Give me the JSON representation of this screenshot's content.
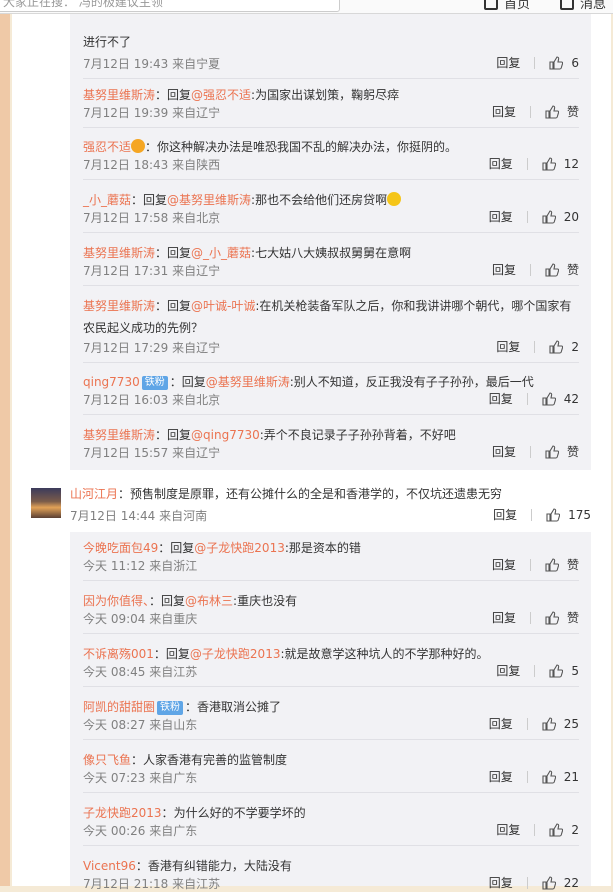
{
  "topbar": {
    "search_text": "大家正在搜：  冯的极建议主领",
    "home_label": "首页",
    "msg_label": "消息"
  },
  "first_partial": {
    "text": "进行不了",
    "time": "7月12日 19:43 来自宁夏",
    "reply": "回复",
    "likes": "6"
  },
  "replies_a": [
    {
      "user": "基努里维斯涛",
      "prefix": "：回复",
      "at": "@强忍不适",
      "body": ":为国家出谋划策，鞠躬尽瘁",
      "time": "7月12日 19:39 来自辽宁",
      "reply": "回复",
      "likes": "赞"
    },
    {
      "user": "强忍不适",
      "emoji": "fire",
      "prefix": "：",
      "at": "",
      "body": "你这种解决办法是唯恐我国不乱的解决办法，你挺阴的。",
      "time": "7月12日 18:43 来自陕西",
      "reply": "回复",
      "likes": "12"
    },
    {
      "user": "_小_蘑菇",
      "prefix": "：回复",
      "at": "@基努里维斯涛",
      "body": ":那也不会给他们还房贷啊",
      "emoji_end": "smile",
      "time": "7月12日 17:58 来自北京",
      "reply": "回复",
      "likes": "20"
    },
    {
      "user": "基努里维斯涛",
      "prefix": "：回复",
      "at": "@_小_蘑菇",
      "body": ":七大姑八大姨叔叔舅舅在意啊",
      "time": "7月12日 17:31 来自辽宁",
      "reply": "回复",
      "likes": "赞"
    },
    {
      "user": "基努里维斯涛",
      "prefix": "：回复",
      "at": "@叶诚-叶诚",
      "body": ":在机关枪装备军队之后，你和我讲讲哪个朝代，哪个国家有",
      "line2": "农民起义成功的先例？",
      "time": "7月12日 17:29 来自辽宁",
      "reply": "回复",
      "likes": "2"
    },
    {
      "user": "qing7730",
      "badge": "铁粉",
      "prefix": "：回复",
      "at": "@基努里维斯涛",
      "body": ":别人不知道，反正我没有子子孙孙，最后一代",
      "time": "7月12日 16:03 来自北京",
      "reply": "回复",
      "likes": "42"
    },
    {
      "user": "基努里维斯涛",
      "prefix": "：回复",
      "at": "@qing7730",
      "body": ":弄个不良记录子子孙孙背着，不好吧",
      "time": "7月12日 15:57 来自辽宁",
      "reply": "回复",
      "likes": "赞"
    }
  ],
  "top_comment": {
    "user": "山河江月",
    "body": "：预售制度是原罪，还有公摊什么的全是和香港学的，不仅坑还遗患无穷",
    "time": "7月12日 14:44 来自河南",
    "reply": "回复",
    "likes": "175"
  },
  "replies_b": [
    {
      "user": "今晚吃面包49",
      "prefix": "：回复",
      "at": "@子龙快跑2013",
      "body": ":那是资本的错",
      "time": "今天 11:12 来自浙江",
      "reply": "回复",
      "likes": "赞"
    },
    {
      "user": "因为你值得、",
      "prefix": "：回复",
      "at": "@布林三",
      "body": ":重庆也没有",
      "time": "今天 09:04 来自重庆",
      "reply": "回复",
      "likes": "赞"
    },
    {
      "user": "不诉离殇001",
      "prefix": "：回复",
      "at": "@子龙快跑2013",
      "body": ":就是故意学这种坑人的不学那种好的。",
      "time": "今天 08:45 来自江苏",
      "reply": "回复",
      "likes": "5"
    },
    {
      "user": "阿凯的甜甜圈",
      "badge": "铁粉",
      "prefix": "：",
      "at": "",
      "body": "香港取消公摊了",
      "time": "今天 08:27 来自山东",
      "reply": "回复",
      "likes": "25"
    },
    {
      "user": "像只飞鱼",
      "prefix": "：",
      "at": "",
      "body": "人家香港有完善的监管制度",
      "time": "今天 07:23 来自广东",
      "reply": "回复",
      "likes": "21"
    },
    {
      "user": "子龙快跑2013",
      "prefix": "：",
      "at": "",
      "body": "为什么好的不学要学坏的",
      "time": "今天 00:26 来自广东",
      "reply": "回复",
      "likes": "2"
    },
    {
      "user": "Vicent96",
      "prefix": "：",
      "at": "",
      "body": "香港有纠错能力，大陆没有",
      "time": "7月12日 21:18 来自江苏",
      "reply": "回复",
      "likes": "22"
    }
  ],
  "colors": {
    "username": "#eb7350",
    "background": "#f5ead6",
    "reply_bg": "#f2f2f5"
  }
}
